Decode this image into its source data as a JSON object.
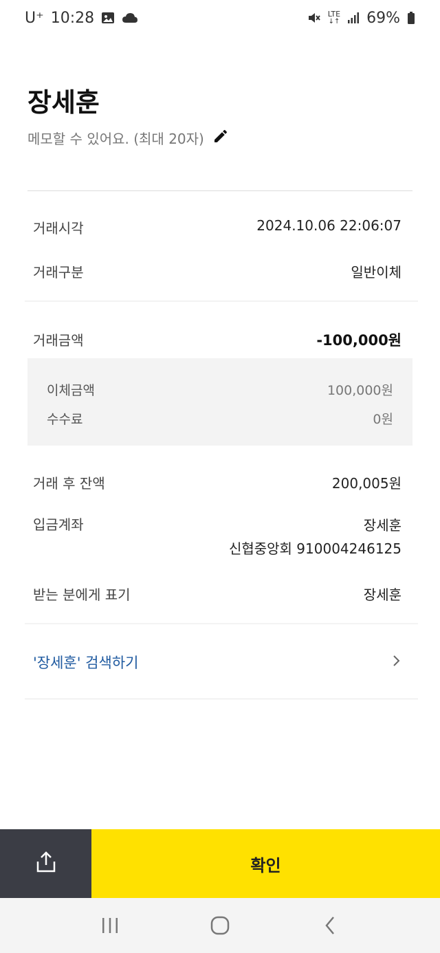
{
  "status_bar": {
    "carrier": "U⁺",
    "time": "10:28",
    "network": "LTE",
    "battery": "69%"
  },
  "header": {
    "title": "장세훈",
    "memo_placeholder": "메모할 수 있어요. (최대 20자)"
  },
  "details": {
    "time_label": "거래시각",
    "time_value": "2024.10.06 22:06:07",
    "type_label": "거래구분",
    "type_value": "일반이체",
    "amount_label": "거래금액",
    "amount_value": "-100,000원",
    "transfer_label": "이체금액",
    "transfer_value": "100,000원",
    "fee_label": "수수료",
    "fee_value": "0원",
    "balance_label": "거래 후 잔액",
    "balance_value": "200,005원",
    "account_label": "입금계좌",
    "account_name": "장세훈",
    "account_bank_number": "신협중앙회 910004246125",
    "display_label": "받는 분에게 표기",
    "display_value": "장세훈"
  },
  "search": {
    "label": "'장세훈' 검색하기"
  },
  "actions": {
    "confirm_label": "확인"
  },
  "icons": {
    "share": "share-icon",
    "edit": "pencil-icon",
    "chevron": "chevron-right-icon"
  }
}
